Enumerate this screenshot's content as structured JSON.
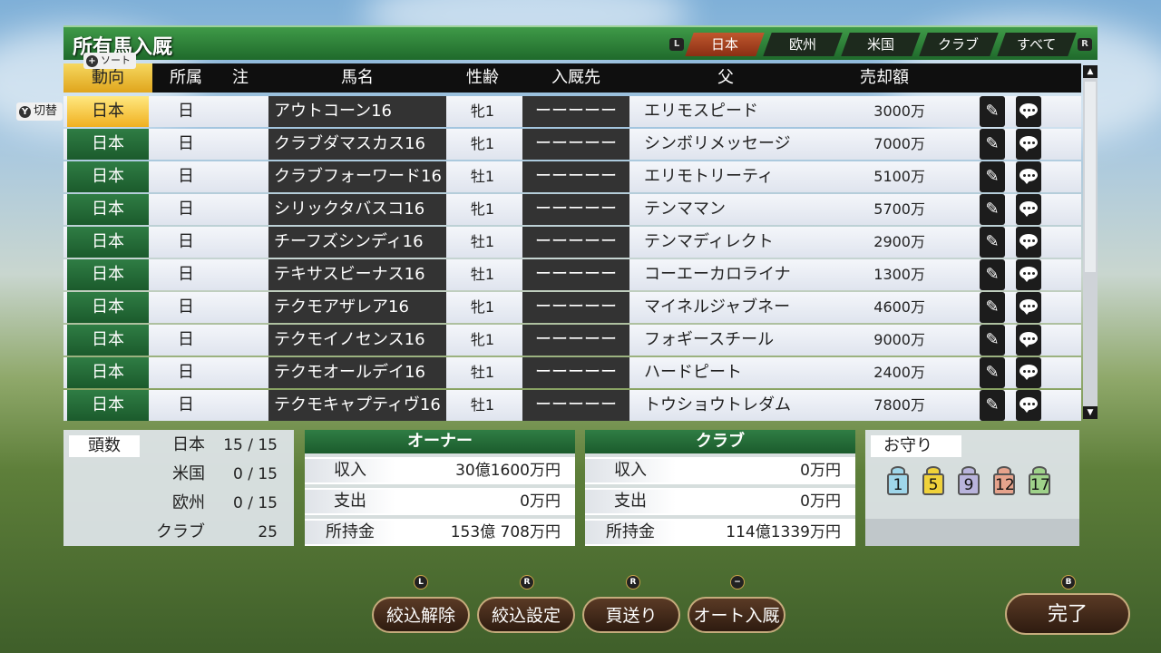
{
  "title": "所有馬入厩",
  "sort_label": "ソート",
  "switch_label": "切替",
  "tabs": {
    "left_key": "L",
    "right_key": "R",
    "items": [
      {
        "label": "日本",
        "active": true
      },
      {
        "label": "欧州",
        "active": false
      },
      {
        "label": "米国",
        "active": false
      },
      {
        "label": "クラブ",
        "active": false
      },
      {
        "label": "すべて",
        "active": false
      }
    ]
  },
  "columns": {
    "trend": "動向",
    "affiliation": "所属",
    "note": "注",
    "name": "馬名",
    "sex_age": "性齢",
    "stable": "入厩先",
    "sire": "父",
    "price": "売却額"
  },
  "rows": [
    {
      "trend": "日本",
      "aff": "日",
      "name": "アウトコーン16",
      "sex": "牝1",
      "stable": "ーーーーー",
      "sire": "エリモスピード",
      "price": "3000万"
    },
    {
      "trend": "日本",
      "aff": "日",
      "name": "クラブダマスカス16",
      "sex": "牝1",
      "stable": "ーーーーー",
      "sire": "シンボリメッセージ",
      "price": "7000万"
    },
    {
      "trend": "日本",
      "aff": "日",
      "name": "クラブフォーワード16",
      "sex": "牡1",
      "stable": "ーーーーー",
      "sire": "エリモトリーティ",
      "price": "5100万"
    },
    {
      "trend": "日本",
      "aff": "日",
      "name": "シリックタバスコ16",
      "sex": "牝1",
      "stable": "ーーーーー",
      "sire": "テンママン",
      "price": "5700万"
    },
    {
      "trend": "日本",
      "aff": "日",
      "name": "チーフズシンディ16",
      "sex": "牡1",
      "stable": "ーーーーー",
      "sire": "テンマディレクト",
      "price": "2900万"
    },
    {
      "trend": "日本",
      "aff": "日",
      "name": "テキサスビーナス16",
      "sex": "牡1",
      "stable": "ーーーーー",
      "sire": "コーエーカロライナ",
      "price": "1300万"
    },
    {
      "trend": "日本",
      "aff": "日",
      "name": "テクモアザレア16",
      "sex": "牝1",
      "stable": "ーーーーー",
      "sire": "マイネルジャブネー",
      "price": "4600万"
    },
    {
      "trend": "日本",
      "aff": "日",
      "name": "テクモイノセンス16",
      "sex": "牝1",
      "stable": "ーーーーー",
      "sire": "フォギースチール",
      "price": "9000万"
    },
    {
      "trend": "日本",
      "aff": "日",
      "name": "テクモオールデイ16",
      "sex": "牡1",
      "stable": "ーーーーー",
      "sire": "ハードピート",
      "price": "2400万"
    },
    {
      "trend": "日本",
      "aff": "日",
      "name": "テクモキャプティヴ16",
      "sex": "牡1",
      "stable": "ーーーーー",
      "sire": "トウショウトレダム",
      "price": "7800万"
    }
  ],
  "counts": {
    "label": "頭数",
    "items": [
      {
        "k": "日本",
        "v": "15 / 15"
      },
      {
        "k": "米国",
        "v": "0 / 15"
      },
      {
        "k": "欧州",
        "v": "0 / 15"
      },
      {
        "k": "クラブ",
        "v": "25"
      }
    ]
  },
  "owner": {
    "title": "オーナー",
    "income_label": "収入",
    "income": "30億1600万円",
    "expense_label": "支出",
    "expense": "0万円",
    "funds_label": "所持金",
    "funds": "153億 708万円"
  },
  "club": {
    "title": "クラブ",
    "income_label": "収入",
    "income": "0万円",
    "expense_label": "支出",
    "expense": "0万円",
    "funds_label": "所持金",
    "funds": "114億1339万円"
  },
  "amulets": {
    "title": "お守り",
    "items": [
      {
        "num": "1",
        "color": "#9fd6ea"
      },
      {
        "num": "5",
        "color": "#f0d23a"
      },
      {
        "num": "9",
        "color": "#b9b4dc"
      },
      {
        "num": "12",
        "color": "#e6a38c"
      },
      {
        "num": "17",
        "color": "#9fd28a"
      }
    ]
  },
  "buttons": {
    "clear_filter": {
      "label": "絞込解除",
      "key": "L"
    },
    "set_filter": {
      "label": "絞込設定",
      "key": "R"
    },
    "page": {
      "label": "頁送り",
      "key": "R"
    },
    "auto": {
      "label": "オート入厩",
      "key": "−"
    },
    "done": {
      "label": "完了",
      "key": "B"
    }
  }
}
